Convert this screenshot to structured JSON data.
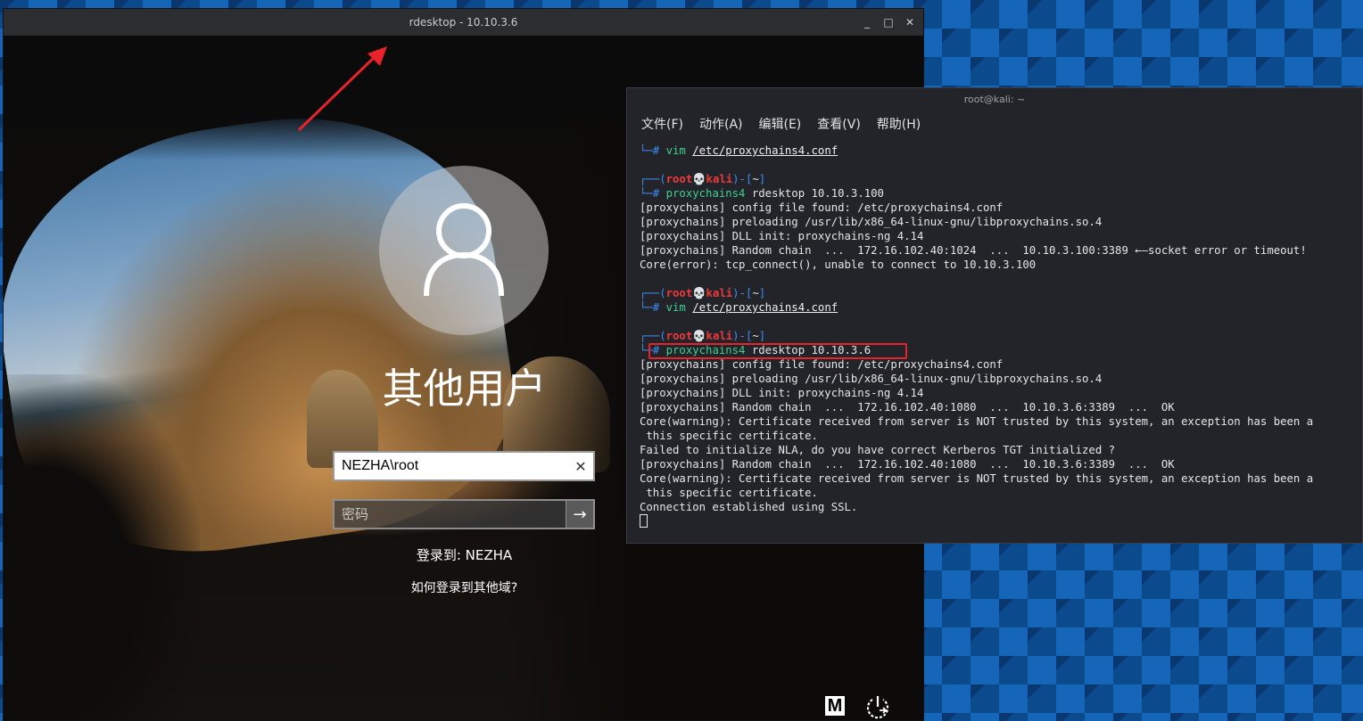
{
  "rdesktop": {
    "title": "rdesktop - 10.10.3.6",
    "lockscreen": {
      "username_title": "其他用户",
      "user_field_value": "NEZHA\\root",
      "password_placeholder": "密码",
      "sign_in_to": "登录到: NEZHA",
      "other_domain_link": "如何登录到其他域?",
      "m_icon_label": "M"
    }
  },
  "terminal": {
    "title": "root@kali: ~",
    "menu": [
      "文件(F)",
      "动作(A)",
      "编辑(E)",
      "查看(V)",
      "帮助(H)"
    ],
    "lines": [
      {
        "kind": "cmd",
        "prefix": "└─# ",
        "cmd": "vim ",
        "arg": "/etc/proxychains4.conf"
      },
      {
        "kind": "blank"
      },
      {
        "kind": "prompt",
        "p1": "┌──(",
        "user": "root💀kali",
        "p2": ")-[",
        "dir": "~",
        "p3": "]"
      },
      {
        "kind": "cmd",
        "prefix": "└─# ",
        "cmd": "proxychains4",
        "rest": " rdesktop 10.10.3.100"
      },
      {
        "kind": "out",
        "text": "[proxychains] config file found: /etc/proxychains4.conf"
      },
      {
        "kind": "out",
        "text": "[proxychains] preloading /usr/lib/x86_64-linux-gnu/libproxychains.so.4"
      },
      {
        "kind": "out",
        "text": "[proxychains] DLL init: proxychains-ng 4.14"
      },
      {
        "kind": "out",
        "text": "[proxychains] Random chain  ...  172.16.102.40:1024  ...  10.10.3.100:3389 ←—socket error or timeout!"
      },
      {
        "kind": "out",
        "text": "Core(error): tcp_connect(), unable to connect to 10.10.3.100"
      },
      {
        "kind": "blank"
      },
      {
        "kind": "prompt",
        "p1": "┌──(",
        "user": "root💀kali",
        "p2": ")-[",
        "dir": "~",
        "p3": "]"
      },
      {
        "kind": "cmd",
        "prefix": "└─# ",
        "cmd": "vim ",
        "arg": "/etc/proxychains4.conf"
      },
      {
        "kind": "blank"
      },
      {
        "kind": "prompt",
        "p1": "┌──(",
        "user": "root💀kali",
        "p2": ")-[",
        "dir": "~",
        "p3": "]"
      },
      {
        "kind": "cmd",
        "prefix": "└─# ",
        "cmd": "proxychains4",
        "rest": " rdesktop 10.10.3.6"
      },
      {
        "kind": "out",
        "text": "[proxychains] config file found: /etc/proxychains4.conf"
      },
      {
        "kind": "out",
        "text": "[proxychains] preloading /usr/lib/x86_64-linux-gnu/libproxychains.so.4"
      },
      {
        "kind": "out",
        "text": "[proxychains] DLL init: proxychains-ng 4.14"
      },
      {
        "kind": "out",
        "text": "[proxychains] Random chain  ...  172.16.102.40:1080  ...  10.10.3.6:3389  ...  OK"
      },
      {
        "kind": "out",
        "text": "Core(warning): Certificate received from server is NOT trusted by this system, an exception has been a"
      },
      {
        "kind": "out",
        "text": " this specific certificate."
      },
      {
        "kind": "out",
        "text": "Failed to initialize NLA, do you have correct Kerberos TGT initialized ?"
      },
      {
        "kind": "out",
        "text": "[proxychains] Random chain  ...  172.16.102.40:1080  ...  10.10.3.6:3389  ...  OK"
      },
      {
        "kind": "out",
        "text": "Core(warning): Certificate received from server is NOT trusted by this system, an exception has been a"
      },
      {
        "kind": "out",
        "text": " this specific certificate."
      },
      {
        "kind": "out",
        "text": "Connection established using SSL."
      },
      {
        "kind": "cursor"
      }
    ]
  },
  "colors": {
    "annotation_red": "#e8232b",
    "prompt_blue": "#3d8cf0",
    "prompt_red": "#f03a3a",
    "command_green": "#3fcf8e"
  }
}
